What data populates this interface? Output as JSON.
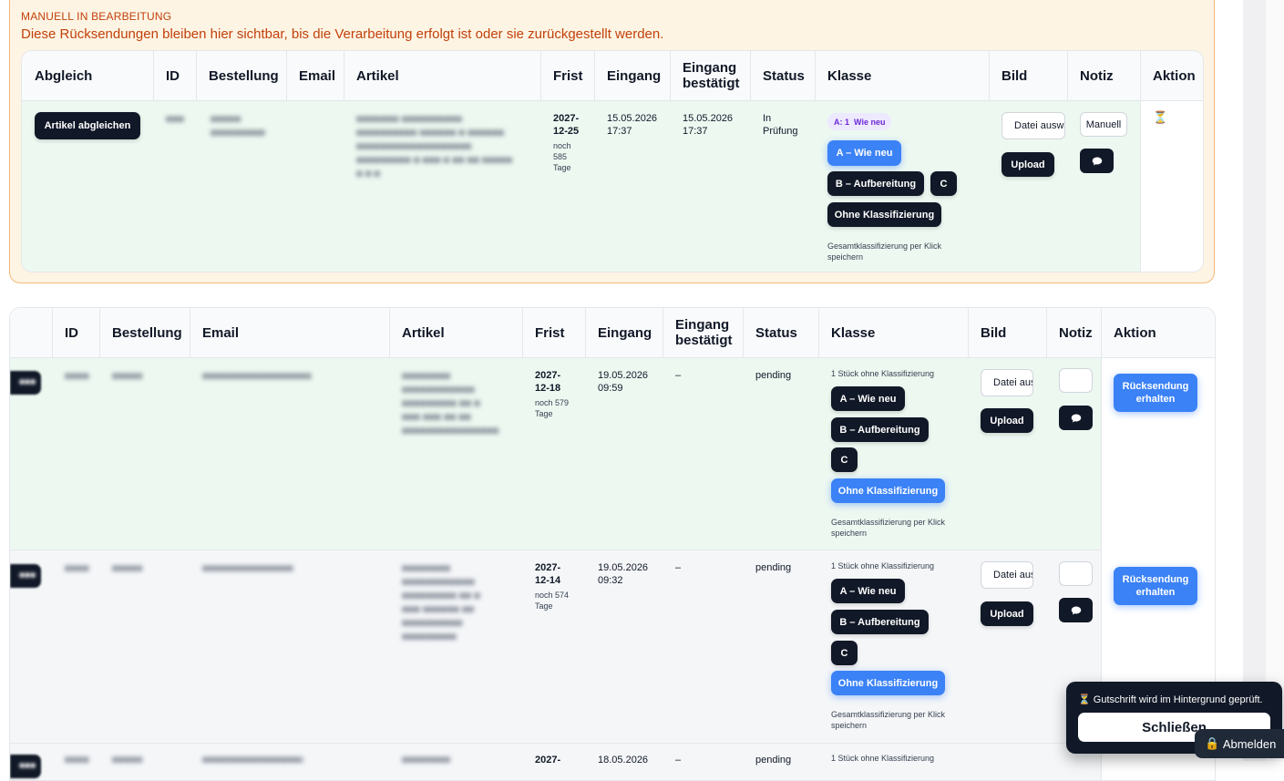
{
  "manual": {
    "title": "MANUELL IN BEARBEITUNG",
    "description": "Diese Rücksendungen bleiben hier sichtbar, bis die Verarbeitung erfolgt ist oder sie zurückgestellt werden.",
    "columns": {
      "abgleich": "Abgleich",
      "id": "ID",
      "bestellung": "Bestellung",
      "email": "Email",
      "artikel": "Artikel",
      "frist": "Frist",
      "eingang": "Eingang",
      "eingang_bestaetigt": "Eingang bestätigt",
      "status": "Status",
      "klasse": "Klasse",
      "bild": "Bild",
      "notiz": "Notiz",
      "aktion": "Aktion"
    },
    "row": {
      "abgleich_button": "Artikel abgleichen",
      "id": "■■■",
      "bestellung": "■■■■■ ■■■■■■■■■",
      "artikel": "■■■■■■■ ■■■■■■■■■■ ■■■■■■■■■■ ■■■■■■ ■ ■■■■■■ ■■■■■■■■■■■■■■■■■■■ ■■■■■■■■■ ■ ■■■ ■ ■■ ■■ ■■■■■ ■ ■ ■",
      "frist_date": "2027-12-25",
      "frist_sub": "noch 585 Tage",
      "eingang": "15.05.2026 17:37",
      "eingang_bestaetigt": "15.05.2026 17:37",
      "status": "In Prüfung",
      "badge_count": "A: 1",
      "badge_label": "Wie neu",
      "class_a": "A – Wie neu",
      "class_b": "B – Aufbereitung",
      "class_c": "C",
      "class_none": "Ohne Klassifizierung",
      "class_note": "Gesamtklassifizierung per Klick speichern",
      "file_label": "Datei auswählen",
      "upload": "Upload",
      "note_value": "Manuell",
      "aktion_icon": "⏳"
    }
  },
  "list": {
    "columns": {
      "id": "ID",
      "bestellung": "Bestellung",
      "email": "Email",
      "artikel": "Artikel",
      "frist": "Frist",
      "eingang": "Eingang",
      "eingang_bestaetigt": "Eingang bestätigt",
      "status": "Status",
      "klasse": "Klasse",
      "bild": "Bild",
      "notiz": "Notiz",
      "aktion": "Aktion"
    },
    "rows": [
      {
        "left_button": "■■■",
        "id": "■■■■",
        "bestellung": "■■■■■",
        "email": "■■■■■■■■■■■■■■■■■■■",
        "artikel": "■■■■■■■■ ■■■■■■■■■■■■ ■■■■■■■■■ ■■ ■ ■■■ ■■■ ■■ ■■ ■■■■■■■■■■■■■■■■",
        "frist_date": "2027-12-18",
        "frist_sub": "noch 579 Tage",
        "eingang": "19.05.2026 09:59",
        "eingang_bestaetigt": "–",
        "status": "pending",
        "class_summary": "1 Stück ohne Klassifizierung",
        "class_a": "A – Wie neu",
        "class_b": "B – Aufbereitung",
        "class_c": "C",
        "class_none": "Ohne Klassifizierung",
        "class_note": "Gesamtklassifizierung per Klick speichern",
        "file_label": "Datei auswählen",
        "upload": "Upload",
        "aktion": "Rücksendung erhalten"
      },
      {
        "left_button": "■■■",
        "id": "■■■■",
        "bestellung": "■■■■■",
        "email": "■■■■■■■■■■■■■■■",
        "artikel": "■■■■■■■■ ■■■■■■■■■■■■ ■■■■■■■■■ ■■ ■ ■■■ ■■■■■■ ■■ ■■■■■■■■■■ ■■■■■■■■■",
        "frist_date": "2027-12-14",
        "frist_sub": "noch 574 Tage",
        "eingang": "19.05.2026 09:32",
        "eingang_bestaetigt": "–",
        "status": "pending",
        "class_summary": "1 Stück ohne Klassifizierung",
        "class_a": "A – Wie neu",
        "class_b": "B – Aufbereitung",
        "class_c": "C",
        "class_none": "Ohne Klassifizierung",
        "class_note": "Gesamtklassifizierung per Klick speichern",
        "file_label": "Datei auswählen",
        "upload": "Upload",
        "aktion": "Rücksendung erhalten"
      },
      {
        "left_button": "■■■",
        "id": "■■■■",
        "bestellung": "■■■■■",
        "email": "■■■■■■■■■■■■■■■■■■",
        "artikel": "■■■■■■■■",
        "frist_date": "2027-",
        "eingang": "18.05.2026",
        "eingang_bestaetigt": "–",
        "status": "pending",
        "class_summary": "1 Stück ohne Klassifizierung"
      }
    ]
  },
  "toast": {
    "icon": "⏳",
    "message": "Gutschrift wird im Hintergrund geprüft.",
    "close_label": "Schließen"
  },
  "logout": {
    "icon": "🔒",
    "label": "Abmelden"
  }
}
